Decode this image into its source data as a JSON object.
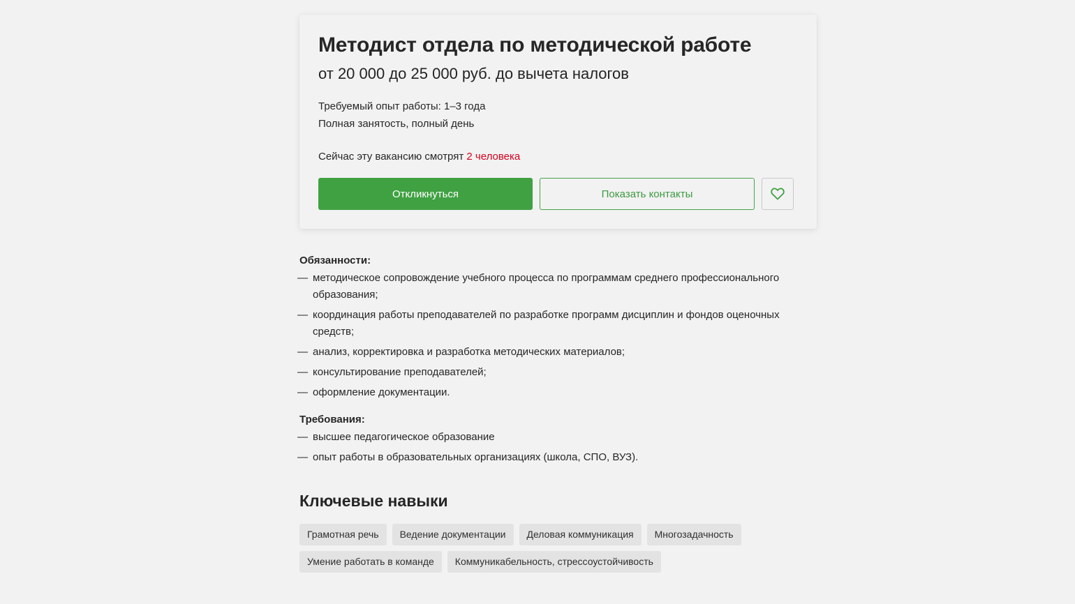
{
  "vacancy": {
    "title": "Методист отдела по методической работе",
    "salary": "от 20 000 до 25 000 руб. до вычета налогов",
    "experience": "Требуемый опыт работы: 1–3 года",
    "employment": "Полная занятость, полный день",
    "watching_prefix": "Сейчас эту вакансию смотрят ",
    "watching_count": "2 человека"
  },
  "actions": {
    "respond_label": "Откликнуться",
    "contacts_label": "Показать контакты",
    "favorite_icon": "heart-icon"
  },
  "description": {
    "responsibilities_heading": "Обязанности:",
    "responsibilities": [
      "методическое сопровождение учебного процесса по программам среднего профессионального образования;",
      "координация работы преподавателей по разработке программ дисциплин и фондов оценочных средств;",
      "анализ, корректировка и разработка методических материалов;",
      "консультирование преподавателей;",
      "оформление документации."
    ],
    "requirements_heading": "Требования:",
    "requirements": [
      "высшее педагогическое образование",
      "опыт работы в образовательных организациях (школа, СПО, ВУЗ)."
    ],
    "dash": "—"
  },
  "skills": {
    "title": "Ключевые навыки",
    "items": [
      "Грамотная речь",
      "Ведение документации",
      "Деловая коммуникация",
      "Многозадачность",
      "Умение работать в команде",
      "Коммуникабельность, стрессоустойчивость"
    ]
  },
  "colors": {
    "accent_green": "#40a142",
    "watching_red": "#d6001c",
    "background": "#f2f2f2",
    "tag_background": "#e3e3e3"
  }
}
